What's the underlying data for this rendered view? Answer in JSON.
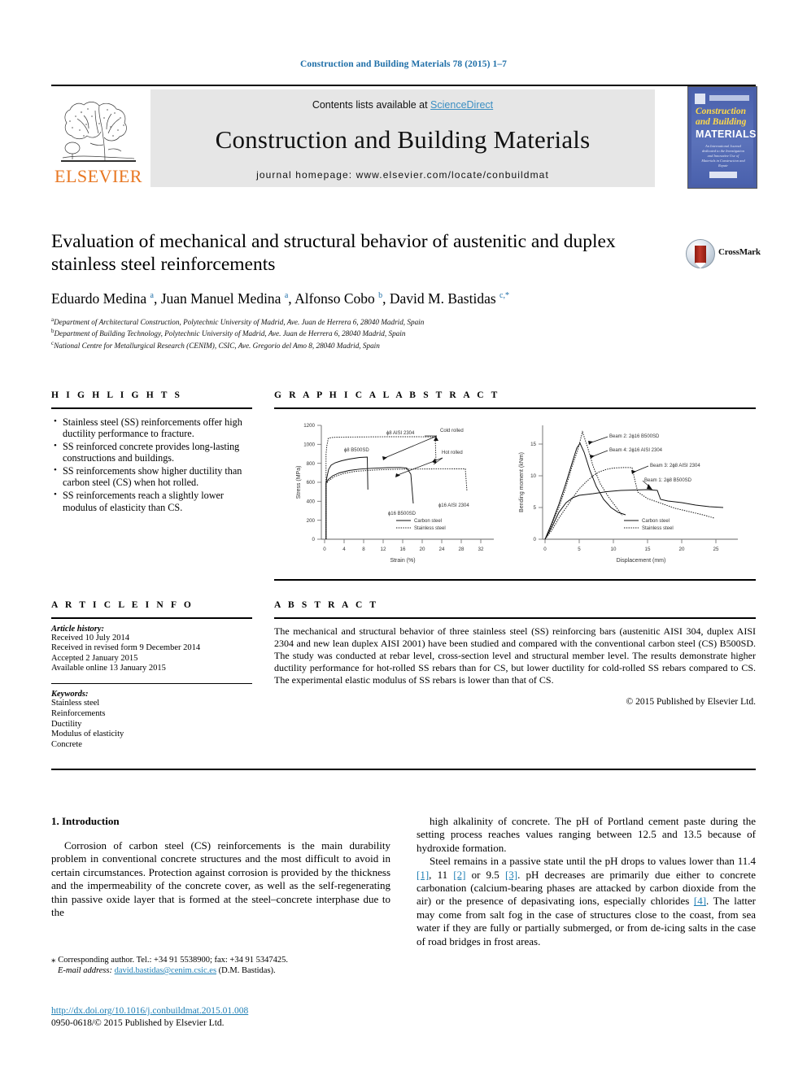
{
  "running_head": "Construction and Building Materials 78 (2015) 1–7",
  "masthead": {
    "contents_prefix": "Contents lists available at ",
    "contents_link": "ScienceDirect",
    "journal_title": "Construction and Building Materials",
    "homepage": "journal homepage: www.elsevier.com/locate/conbuildmat",
    "publisher_logo_text": "ELSEVIER",
    "cover": {
      "line1": "Construction",
      "line2": "and Building",
      "line3": "MATERIALS",
      "blurb": "An International Journal dedicated to the Investigation and Innovative Use of Materials in Construction and Repair"
    }
  },
  "article": {
    "title": "Evaluation of mechanical and structural behavior of austenitic and duplex stainless steel reinforcements",
    "authors_html": "Eduardo Medina <sup>a</sup>, Juan Manuel Medina <sup>a</sup>, Alfonso Cobo <sup>b</sup>, David M. Bastidas <sup>c,*</sup>",
    "authors_plain": "Eduardo Medina a, Juan Manuel Medina a, Alfonso Cobo b, David M. Bastidas c,*",
    "affiliations": [
      {
        "marker": "a",
        "text": "Department of Architectural Construction, Polytechnic University of Madrid, Ave. Juan de Herrera 6, 28040 Madrid, Spain"
      },
      {
        "marker": "b",
        "text": "Department of Building Technology, Polytechnic University of Madrid, Ave. Juan de Herrera 6, 28040 Madrid, Spain"
      },
      {
        "marker": "c",
        "text": "National Centre for Metallurgical Research (CENIM), CSIC, Ave. Gregorio del Amo 8, 28040 Madrid, Spain"
      }
    ],
    "crossmark_label": "CrossMark"
  },
  "highlights": {
    "heading": "H I G H L I G H T S",
    "items": [
      "Stainless steel (SS) reinforcements offer high ductility performance to fracture.",
      "SS reinforced concrete provides long-lasting constructions and buildings.",
      "SS reinforcements show higher ductility than carbon steel (CS) when hot rolled.",
      "SS reinforcements reach a slightly lower modulus of elasticity than CS."
    ]
  },
  "graphical_abstract": {
    "heading": "G R A P H I C A L   A B S T R A C T"
  },
  "article_info": {
    "heading": "A R T I C L E   I N F O",
    "history_label": "Article history:",
    "history": [
      "Received 10 July 2014",
      "Received in revised form 9 December 2014",
      "Accepted 2 January 2015",
      "Available online 13 January 2015"
    ],
    "keywords_label": "Keywords:",
    "keywords": [
      "Stainless steel",
      "Reinforcements",
      "Ductility",
      "Modulus of elasticity",
      "Concrete"
    ]
  },
  "abstract": {
    "heading": "A B S T R A C T",
    "text": "The mechanical and structural behavior of three stainless steel (SS) reinforcing bars (austenitic AISI 304, duplex AISI 2304 and new lean duplex AISI 2001) have been studied and compared with the conventional carbon steel (CS) B500SD. The study was conducted at rebar level, cross-section level and structural member level. The results demonstrate higher ductility performance for hot-rolled SS rebars than for CS, but lower ductility for cold-rolled SS rebars compared to CS. The experimental elastic modulus of SS rebars is lower than that of CS.",
    "copyright": "© 2015 Published by Elsevier Ltd."
  },
  "body": {
    "section_title": "1. Introduction",
    "left_paragraph": "Corrosion of carbon steel (CS) reinforcements is the main durability problem in conventional concrete structures and the most difficult to avoid in certain circumstances. Protection against corrosion is provided by the thickness and the impermeability of the concrete cover, as well as the self-regenerating thin passive oxide layer that is formed at the steel–concrete interphase due to the",
    "right_paragraph_1": "high alkalinity of concrete. The pH of Portland cement paste during the setting process reaches values ranging between 12.5 and 13.5 because of hydroxide formation.",
    "right_paragraph_2_parts": {
      "p1": "Steel remains in a passive state until the pH drops to values lower than 11.4 ",
      "c1": "[1]",
      "p2": ", 11 ",
      "c2": "[2]",
      "p3": " or 9.5 ",
      "c3": "[3]",
      "p4": ". pH decreases are primarily due either to concrete carbonation (calcium-bearing phases are attacked by carbon dioxide from the air) or the presence of depasivating ions, especially chlorides ",
      "c4": "[4]",
      "p5": ". The latter may come from salt fog in the case of structures close to the coast, from sea water if they are fully or partially submerged, or from de-icing salts in the case of road bridges in frost areas."
    }
  },
  "footer": {
    "corresponding": "Corresponding author. Tel.: +34 91 5538900; fax: +34 91 5347425.",
    "email_label": "E-mail address:",
    "email": "david.bastidas@cenim.csic.es",
    "email_owner": "(D.M. Bastidas).",
    "doi": "http://dx.doi.org/10.1016/j.conbuildmat.2015.01.008",
    "issn": "0950-0618/© 2015 Published by Elsevier Ltd."
  },
  "colors": {
    "link": "#1f7fb5",
    "sciencedirect": "#3b8ec2",
    "elsevier_orange": "#E87722",
    "cover_blue": "#4a61ad",
    "cover_yellow": "#ffd94a"
  },
  "chart_data": [
    {
      "type": "line",
      "title": "",
      "xlabel": "Strain (%)",
      "ylabel": "Stress (MPa)",
      "xlim": [
        0,
        34
      ],
      "ylim": [
        0,
        1200
      ],
      "xticks": [
        0,
        4,
        8,
        12,
        16,
        20,
        24,
        28,
        32
      ],
      "yticks": [
        0,
        200,
        400,
        600,
        800,
        1000,
        1200
      ],
      "grid": false,
      "legend": [
        "Carbon steel",
        "Stainless steel"
      ],
      "legend_position": "lower-right",
      "annotations": [
        "φ8 AISI 2304",
        "φ8 B500SD",
        "φ16 AISI 2304",
        "φ16 B500SD",
        "Cold rolled",
        "Hot rolled"
      ],
      "series": [
        {
          "name": "φ8 B500SD",
          "style": "solid",
          "material": "carbon steel",
          "points": [
            [
              0,
              0
            ],
            [
              0.3,
              600
            ],
            [
              0.6,
              700
            ],
            [
              1.2,
              800
            ],
            [
              2,
              840
            ],
            [
              4,
              865
            ],
            [
              6,
              878
            ],
            [
              8,
              884
            ],
            [
              8.8,
              885
            ],
            [
              9.0,
              520
            ]
          ]
        },
        {
          "name": "φ16 B500SD",
          "style": "solid",
          "material": "carbon steel",
          "points": [
            [
              0,
              0
            ],
            [
              0.3,
              590
            ],
            [
              1,
              640
            ],
            [
              3,
              680
            ],
            [
              6,
              705
            ],
            [
              9,
              722
            ],
            [
              12,
              730
            ],
            [
              15,
              733
            ],
            [
              17,
              730
            ],
            [
              18.5,
              690
            ],
            [
              19.5,
              380
            ]
          ]
        },
        {
          "name": "φ8 AISI 2304",
          "style": "dotted",
          "material": "stainless steel",
          "points": [
            [
              0,
              0
            ],
            [
              0.4,
              900
            ],
            [
              0.8,
              1040
            ],
            [
              1.5,
              1060
            ],
            [
              6,
              1065
            ],
            [
              14,
              1068
            ],
            [
              20,
              1068
            ],
            [
              23,
              1065
            ],
            [
              23.3,
              800
            ]
          ]
        },
        {
          "name": "φ16 AISI 2304",
          "style": "dotted",
          "material": "stainless steel",
          "points": [
            [
              0,
              0
            ],
            [
              0.3,
              580
            ],
            [
              1,
              620
            ],
            [
              4,
              670
            ],
            [
              8,
              700
            ],
            [
              14,
              715
            ],
            [
              20,
              720
            ],
            [
              26,
              722
            ],
            [
              29.5,
              722
            ],
            [
              30,
              500
            ]
          ]
        }
      ]
    },
    {
      "type": "line",
      "title": "",
      "xlabel": "Displacement (mm)",
      "ylabel": "Bending moment (kNm)",
      "xlim": [
        0,
        27
      ],
      "ylim": [
        0,
        18
      ],
      "xticks": [
        0,
        5,
        10,
        15,
        20,
        25
      ],
      "yticks": [
        0,
        5,
        10,
        15
      ],
      "grid": false,
      "legend": [
        "Carbon steel",
        "Stainless steel"
      ],
      "legend_position": "lower-right",
      "annotations": [
        "Beam 2: 2φ16 B500SD",
        "Beam 4: 2φ16 AISI 2304",
        "Beam 3: 2φ8 AISI 2304",
        "Beam 1: 2φ8 B500SD"
      ],
      "series": [
        {
          "name": "Beam 2: 2φ16 B500SD",
          "style": "solid",
          "material": "carbon steel",
          "points": [
            [
              0,
              0
            ],
            [
              1,
              2.5
            ],
            [
              2,
              5.5
            ],
            [
              3,
              8.5
            ],
            [
              4,
              11.5
            ],
            [
              5,
              14.5
            ],
            [
              5.8,
              16.4
            ],
            [
              6.5,
              15.5
            ],
            [
              7.5,
              13.5
            ],
            [
              9,
              10.5
            ],
            [
              10.5,
              8.0
            ],
            [
              11.5,
              6.5
            ],
            [
              12.5,
              5.6
            ],
            [
              13,
              5.2
            ]
          ]
        },
        {
          "name": "Beam 4: 2φ16 AISI 2304",
          "style": "dotted",
          "material": "stainless steel",
          "points": [
            [
              0,
              0
            ],
            [
              1,
              2.2
            ],
            [
              2,
              5.0
            ],
            [
              3,
              8.0
            ],
            [
              4,
              11.0
            ],
            [
              5,
              14.0
            ],
            [
              6,
              16.3
            ],
            [
              6.6,
              17.0
            ],
            [
              7.5,
              15.0
            ],
            [
              9,
              11.5
            ],
            [
              10.5,
              8.5
            ],
            [
              11.5,
              6.5
            ],
            [
              12.3,
              5.0
            ]
          ]
        },
        {
          "name": "Beam 1: 2φ8 B500SD",
          "style": "solid",
          "material": "carbon steel",
          "points": [
            [
              0,
              0
            ],
            [
              1,
              2.0
            ],
            [
              2,
              4.2
            ],
            [
              3,
              5.8
            ],
            [
              4,
              6.6
            ],
            [
              5,
              6.9
            ],
            [
              7,
              7.2
            ],
            [
              9,
              7.5
            ],
            [
              11,
              7.7
            ],
            [
              13,
              7.8
            ],
            [
              15,
              7.85
            ],
            [
              16.5,
              7.8
            ],
            [
              17,
              6.3
            ],
            [
              18,
              6.0
            ],
            [
              20,
              5.7
            ],
            [
              22,
              5.4
            ],
            [
              24,
              5.2
            ],
            [
              26,
              5.0
            ]
          ]
        },
        {
          "name": "Beam 3: 2φ8 AISI 2304",
          "style": "dotted",
          "material": "stainless steel",
          "points": [
            [
              0,
              0
            ],
            [
              1,
              1.5
            ],
            [
              2,
              3.3
            ],
            [
              3,
              5.0
            ],
            [
              4,
              6.6
            ],
            [
              5,
              8.0
            ],
            [
              6,
              9.2
            ],
            [
              7,
              10.0
            ],
            [
              8,
              10.6
            ],
            [
              9,
              11.0
            ],
            [
              10,
              11.2
            ],
            [
              11,
              11.3
            ],
            [
              12,
              11.35
            ],
            [
              12.8,
              11.3
            ],
            [
              13.2,
              9.0
            ],
            [
              13.5,
              7.5
            ],
            [
              15,
              6.4
            ],
            [
              17,
              5.6
            ],
            [
              19,
              4.8
            ],
            [
              21,
              4.2
            ],
            [
              23,
              3.8
            ],
            [
              24.8,
              3.3
            ]
          ]
        }
      ]
    }
  ]
}
